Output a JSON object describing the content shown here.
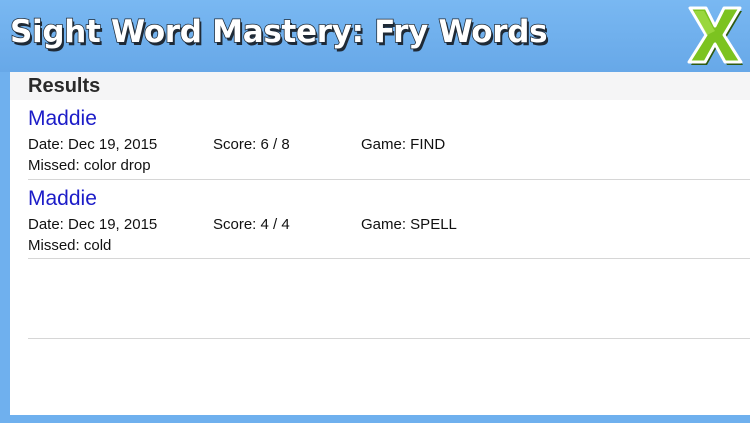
{
  "app": {
    "title": "Sight Word Mastery: Fry Words"
  },
  "close_button": {
    "glyph": "X",
    "icon": "close-x-icon",
    "colors": {
      "fill": "#7cc320",
      "outline": "#2f5a10"
    }
  },
  "panel": {
    "title": "Results"
  },
  "results": [
    {
      "name": "Maddie",
      "date": "Date: Dec 19, 2015",
      "score": "Score: 6 / 8",
      "game": "Game: FIND",
      "missed": "Missed: color drop"
    },
    {
      "name": "Maddie",
      "date": "Date: Dec 19, 2015",
      "score": "Score: 4 / 4",
      "game": "Game: SPELL",
      "missed": "Missed: cold"
    }
  ],
  "colors": {
    "background": "#6fb0ee",
    "name_link": "#1c1cc8",
    "panel": "#ffffff",
    "header": "#f5f5f6"
  }
}
